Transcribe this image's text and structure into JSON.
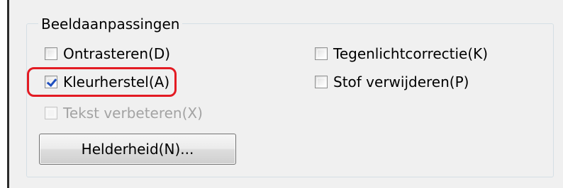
{
  "group": {
    "title": "Beeldaanpassingen"
  },
  "options": {
    "ontrasteren": {
      "label": "Ontrasteren(D)",
      "checked": false,
      "enabled": true
    },
    "kleurherstel": {
      "label": "Kleurherstel(A)",
      "checked": true,
      "enabled": true
    },
    "tekst_verbeteren": {
      "label": "Tekst verbeteren(X)",
      "checked": false,
      "enabled": false
    },
    "tegenlichtcorrectie": {
      "label": "Tegenlichtcorrectie(K)",
      "checked": false,
      "enabled": true
    },
    "stof_verwijderen": {
      "label": "Stof verwijderen(P)",
      "checked": false,
      "enabled": true
    }
  },
  "buttons": {
    "helderheid": "Helderheid(N)..."
  },
  "colors": {
    "panel_background": "#f0f0f0",
    "highlight": "#e31b23",
    "checkmark": "#1f4fbf",
    "disabled_text": "#a3a3a3"
  }
}
